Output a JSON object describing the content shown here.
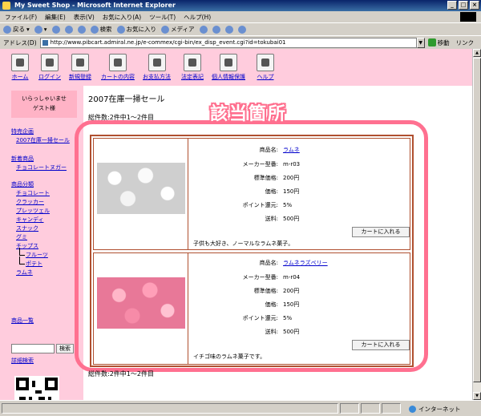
{
  "window": {
    "title": "My Sweet Shop - Microsoft Internet Explorer"
  },
  "menu": [
    "ファイル(F)",
    "編集(E)",
    "表示(V)",
    "お気に入り(A)",
    "ツール(T)",
    "ヘルプ(H)"
  ],
  "toolbar": {
    "back": "戻る",
    "search": "検索",
    "favorites": "お気に入り",
    "media": "メディア"
  },
  "address": {
    "label": "アドレス(D)",
    "url": "http://www.pibcart.admiral.ne.jp/e-commex/cgi-bin/ex_disp_event.cgi?id=tokubai01",
    "go": "移動",
    "links": "リンク"
  },
  "nav": [
    "ホーム",
    "ログイン",
    "新規登録",
    "カートの内容",
    "お支払方法",
    "法定表記",
    "個人情報保護",
    "ヘルプ"
  ],
  "sidebar": {
    "welcome_line1": "いらっしゃいませ",
    "welcome_line2": "ゲスト様",
    "special_head": "特売企画",
    "special_item": "2007在庫一掃セール",
    "new_head": "新着商品",
    "new_item": "チョコレートヌガー",
    "cat_head": "商品分類",
    "cats": [
      "チョコレート",
      "クラッカー",
      "プレッツェル",
      "キャンディ",
      "スナック",
      "グミ",
      "チップス"
    ],
    "subcats": [
      "フルーツ",
      "ポテト"
    ],
    "cat_last": "ラムネ",
    "list_head": "商品一覧",
    "search_btn": "検索",
    "adv_search": "詳細検索"
  },
  "main": {
    "title": "2007在庫一掃セール",
    "count": "総件数:2件中1～2件目",
    "highlight": "該当箇所",
    "labels": {
      "name": "商品名:",
      "code": "メーカー型番:",
      "std_price": "標準価格:",
      "price": "価格:",
      "points": "ポイント還元:",
      "shipping": "送料:"
    },
    "cart_btn": "カートに入れる",
    "products": [
      {
        "name": "ラムネ",
        "code": "m-r03",
        "std_price": "200円",
        "price": "150円",
        "points": "5%",
        "shipping": "500円",
        "desc": "子供も大好き、ノーマルなラムネ菓子。"
      },
      {
        "name": "ラムネラズベリー",
        "code": "m-r04",
        "std_price": "200円",
        "price": "150円",
        "points": "5%",
        "shipping": "500円",
        "desc": "イチゴ味のラムネ菓子です。"
      }
    ]
  },
  "status": {
    "zone": "インターネット"
  }
}
